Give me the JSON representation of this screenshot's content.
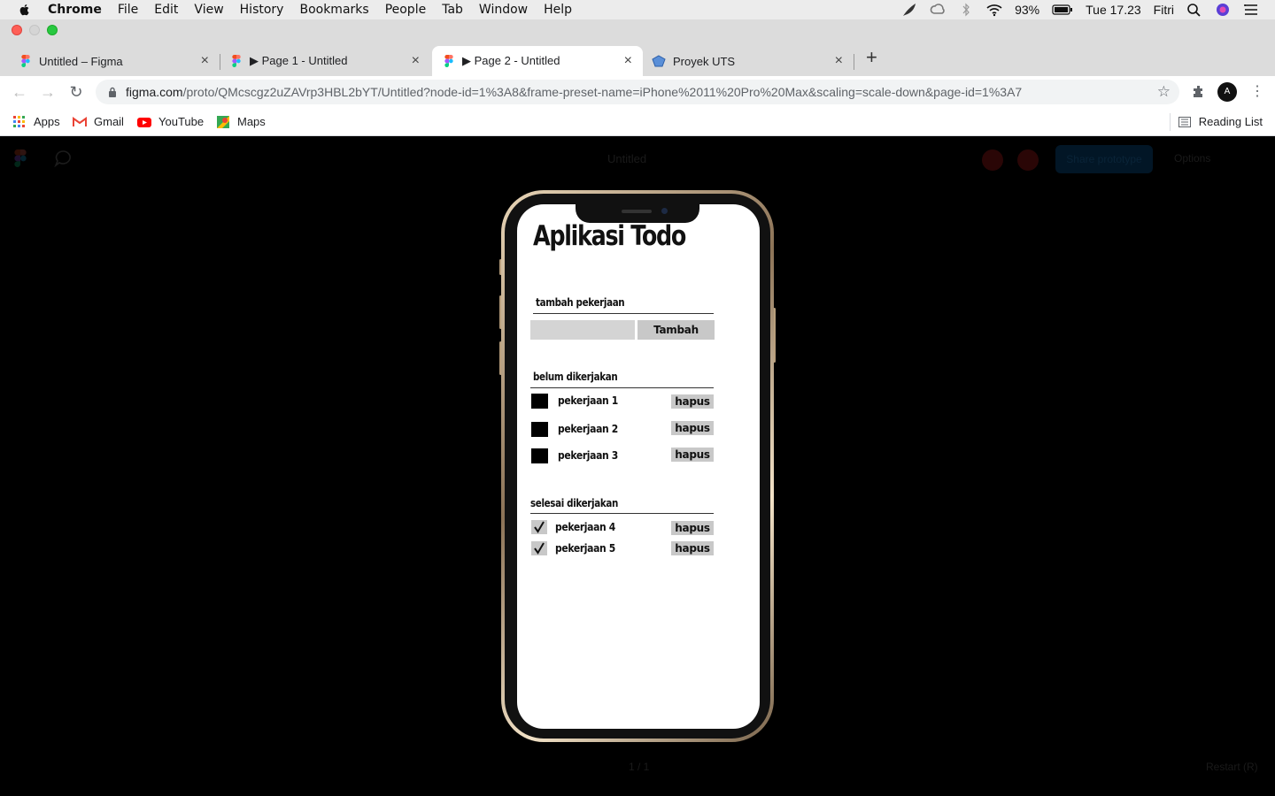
{
  "menubar": {
    "app_name": "Chrome",
    "items": [
      "File",
      "Edit",
      "View",
      "History",
      "Bookmarks",
      "People",
      "Tab",
      "Window",
      "Help"
    ],
    "battery": "93%",
    "clock": "Tue 17.23",
    "user": "Fitri"
  },
  "tabs": [
    {
      "title": "Untitled – Figma"
    },
    {
      "title": "▶ Page 1 - Untitled"
    },
    {
      "title": "▶ Page 2 - Untitled"
    },
    {
      "title": "Proyek UTS"
    }
  ],
  "address": {
    "host": "figma.com",
    "path": "/proto/QMcscgz2uZAVrp3HBL2bYT/Untitled?node-id=1%3A8&frame-preset-name=iPhone%2011%20Pro%20Max&scaling=scale-down&page-id=1%3A7"
  },
  "bookmarks": {
    "items": [
      "Apps",
      "Gmail",
      "YouTube",
      "Maps"
    ],
    "reading_list": "Reading List"
  },
  "viewer": {
    "doc_title": "Untitled",
    "share_label": "Share prototype",
    "options_label": "Options",
    "page_counter": "1 / 1",
    "restart_label": "Restart (R)"
  },
  "app": {
    "title": "Aplikasi Todo",
    "add_section_label": "tambah pekerjaan",
    "add_input_value": "",
    "add_button": "Tambah",
    "pending_label": "belum dikerjakan",
    "pending": [
      {
        "name": "pekerjaan 1",
        "delete": "hapus"
      },
      {
        "name": "pekerjaan 2",
        "delete": "hapus"
      },
      {
        "name": "pekerjaan 3",
        "delete": "hapus"
      }
    ],
    "done_label": "selesai dikerjakan",
    "done": [
      {
        "name": "pekerjaan 4",
        "delete": "hapus"
      },
      {
        "name": "pekerjaan 5",
        "delete": "hapus"
      }
    ]
  }
}
